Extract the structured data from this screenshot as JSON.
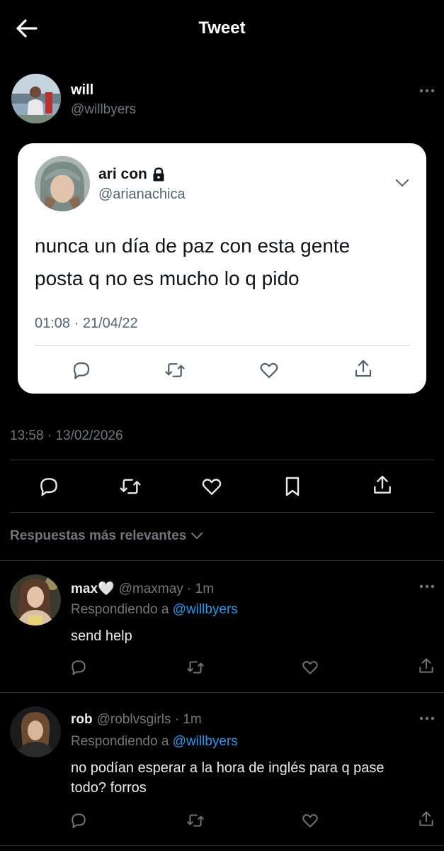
{
  "header": {
    "title": "Tweet",
    "back_icon": "arrow-left-icon"
  },
  "author": {
    "name": "will",
    "handle": "@willbyers"
  },
  "quoted_tweet": {
    "name": "ari con",
    "lock_icon": "lock-icon",
    "handle": "@arianachica",
    "text_line1": "nunca un día de paz con esta gente",
    "text_line2": "posta q no es mucho lo q pido",
    "timestamp": "01:08 · 21/04/22"
  },
  "tweet": {
    "timestamp": "13:58 · 13/02/2026"
  },
  "replies_section": {
    "sort_label": "Respuestas más relevantes"
  },
  "replies": [
    {
      "name": "max🤍",
      "meta": "@maxmay · 1m",
      "replying_prefix": "Respondiendo a",
      "replying_to": "@willbyers",
      "text": "send help"
    },
    {
      "name": "rob",
      "meta": "@roblvsgirls · 1m",
      "replying_prefix": "Respondiendo a",
      "replying_to": "@willbyers",
      "text_line1": "no podían esperar a la hora de inglés para q pase",
      "text_line2": "todo? forros"
    }
  ],
  "colors": {
    "background": "#000000",
    "link": "#1d9bf0",
    "muted": "#71767b",
    "card": "#ffffff"
  }
}
